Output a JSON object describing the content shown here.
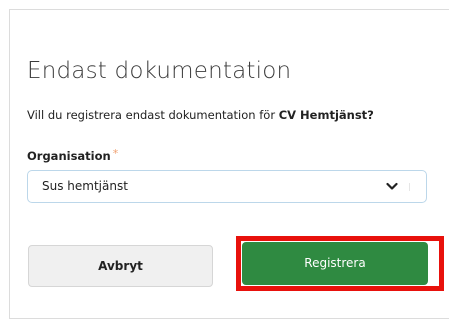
{
  "dialog": {
    "title": "Endast dokumentation",
    "question_prefix": "Vill du registrera endast dokumentation för ",
    "question_subject": "CV Hemtjänst?",
    "field": {
      "label": "Organisation",
      "required_marker": "*",
      "selected_value": "Sus hemtjänst"
    },
    "buttons": {
      "cancel_label": "Avbryt",
      "submit_label": "Registrera"
    }
  },
  "icons": {
    "select_chevron": "chevron-down-icon"
  },
  "colors": {
    "primary": "#2f8a41",
    "highlight": "#e8110c",
    "required": "#f0a070",
    "select_border": "#bcd7ea"
  }
}
